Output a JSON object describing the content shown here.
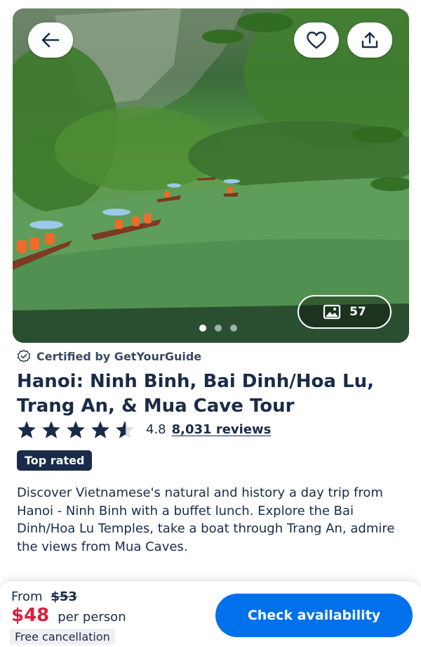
{
  "hero": {
    "photo_count": "57",
    "carousel_dots": 3,
    "active_dot": 0,
    "icons": {
      "back": "arrow-left-icon",
      "favorite": "heart-icon",
      "share": "share-icon",
      "gallery": "image-icon"
    }
  },
  "certification": {
    "label": "Certified by GetYourGuide",
    "icon": "badge-check-icon"
  },
  "tour": {
    "title": "Hanoi: Ninh Binh, Bai Dinh/Hoa Lu, Trang An, & Mua Cave Tour",
    "rating": "4.8",
    "rating_value": 4.8,
    "reviews": "8,031 reviews",
    "badge": "Top rated",
    "description": "Discover Vietnamese's natural and history a day trip from Hanoi - Ninh Binh with a buffet lunch. Explore the Bai Dinh/Hoa Lu Temples, take a boat through Trang An, admire the views from Mua Caves."
  },
  "booking": {
    "from_label": "From",
    "original_price": "$53",
    "price": "$48",
    "per_person": "per person",
    "free_cancellation": "Free cancellation",
    "cta": "Check availability"
  },
  "colors": {
    "navy": "#1a2b49",
    "price_red": "#dc1e3c",
    "cta_blue": "#0071eb"
  }
}
